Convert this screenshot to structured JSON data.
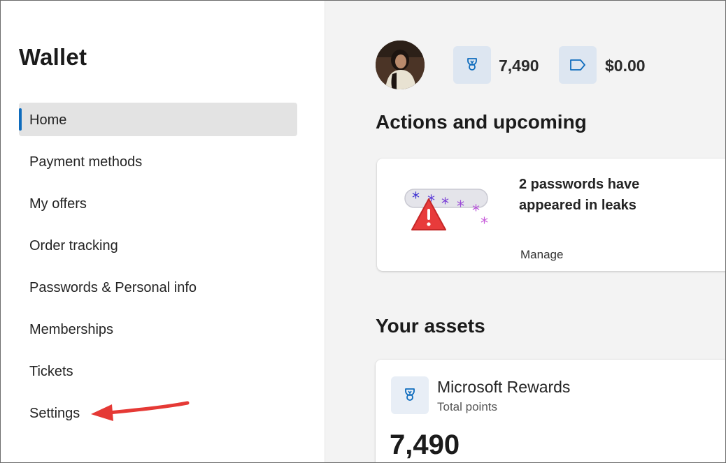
{
  "sidebar": {
    "title": "Wallet",
    "items": [
      {
        "label": "Home",
        "active": true
      },
      {
        "label": "Payment methods",
        "active": false
      },
      {
        "label": "My offers",
        "active": false
      },
      {
        "label": "Order tracking",
        "active": false
      },
      {
        "label": "Passwords & Personal info",
        "active": false
      },
      {
        "label": "Memberships",
        "active": false
      },
      {
        "label": "Tickets",
        "active": false
      },
      {
        "label": "Settings",
        "active": false
      }
    ]
  },
  "header": {
    "points_icon": "trophy-icon",
    "points_value": "7,490",
    "cash_icon": "tag-icon",
    "cash_value": "$0.00"
  },
  "actions": {
    "title": "Actions and upcoming",
    "alert_text": "2 passwords have appeared in leaks",
    "alert_icon": "password-warning-icon",
    "manage_label": "Manage"
  },
  "assets": {
    "title": "Your assets",
    "rewards_icon": "trophy-icon",
    "rewards_title": "Microsoft Rewards",
    "rewards_subtitle": "Total points",
    "rewards_points": "7,490"
  },
  "colors": {
    "accent": "#0f6cbd",
    "active_bg": "#e3e3e3",
    "arrow": "#e53935",
    "chip_bg": "#dde6f1",
    "main_bg": "#f3f3f3"
  }
}
